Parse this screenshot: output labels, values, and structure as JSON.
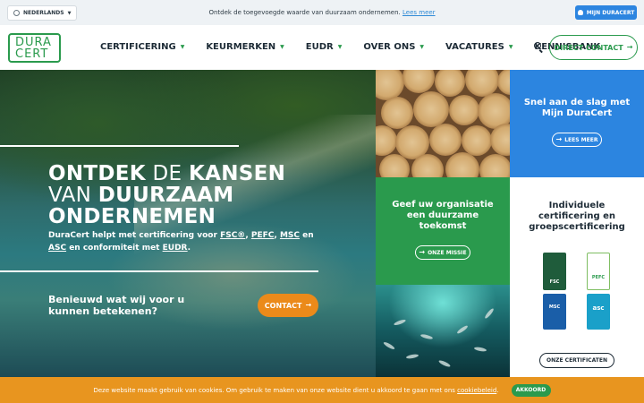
{
  "topbar": {
    "language": "NEDERLANDS",
    "announcement": "Ontdek de toegevoegde waarde van duurzaam ondernemen.",
    "announcement_link": "Lees meer",
    "account_button": "MIJN DURACERT"
  },
  "header": {
    "logo_line1": "DURA",
    "logo_line2": "CERT",
    "nav": [
      "CERTIFICERING",
      "KEURMERKEN",
      "EUDR",
      "OVER ONS",
      "VACATURES",
      "KENNISBANK"
    ],
    "contact_button": "DIRECT CONTACT"
  },
  "hero": {
    "title_bold1": "ONTDEK",
    "title_light1": "DE",
    "title_bold2": "KANSEN",
    "title_light2": "VAN",
    "title_bold3": "DUURZAAM",
    "title_bold4": "ONDERNEMEN",
    "subtitle_pre": "DuraCert helpt met certificering voor",
    "fsc": "FSC®",
    "pefc": "PEFC",
    "msc": "MSC",
    "and": "en",
    "asc": "ASC",
    "subtitle_mid": "en conformiteit met",
    "eudr": "EUDR",
    "question": "Benieuwd wat wij voor u kunnen betekenen?",
    "cta": "CONTACT"
  },
  "tiles": {
    "blue_title": "Snel aan de slag met Mijn DuraCert",
    "blue_button": "LEES MEER",
    "green_title": "Geef uw organisatie een duurzame toekomst",
    "green_button": "ONZE MISSIE",
    "white_title": "Individuele certificering en groepscertificering",
    "white_button": "ONZE CERTIFICATEN",
    "cert_labels": [
      "FSC",
      "PEFC",
      "MSC",
      "asc"
    ]
  },
  "cookie": {
    "text": "Deze website maakt gebruik van cookies. Om gebruik te maken van onze website dient u akkoord te gaan met ons",
    "link": "cookiebeleid",
    "accept": "AKKOORD"
  },
  "colors": {
    "brand_green": "#2a9a4d",
    "brand_blue": "#2c85e0",
    "accent_orange": "#eb8a1a",
    "cookie_orange": "#e8951f"
  }
}
